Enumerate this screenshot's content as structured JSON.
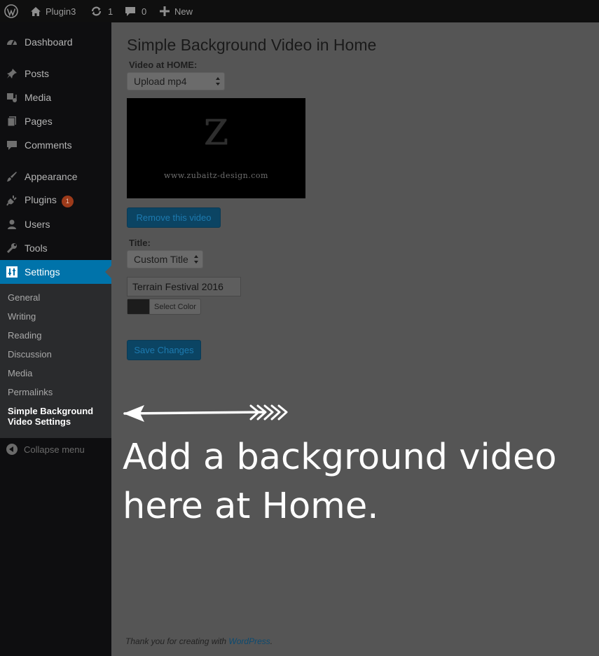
{
  "adminbar": {
    "site_name": "Plugin3",
    "updates_count": "1",
    "comments_count": "0",
    "new_label": "New"
  },
  "sidebar": {
    "items": [
      {
        "label": "Dashboard",
        "icon": "dashboard-icon"
      },
      {
        "label": "Posts",
        "icon": "pin-icon"
      },
      {
        "label": "Media",
        "icon": "media-icon"
      },
      {
        "label": "Pages",
        "icon": "pages-icon"
      },
      {
        "label": "Comments",
        "icon": "comment-icon"
      },
      {
        "label": "Appearance",
        "icon": "brush-icon"
      },
      {
        "label": "Plugins",
        "icon": "plug-icon",
        "badge": "1"
      },
      {
        "label": "Users",
        "icon": "user-icon"
      },
      {
        "label": "Tools",
        "icon": "wrench-icon"
      },
      {
        "label": "Settings",
        "icon": "settings-icon"
      }
    ],
    "submenu": [
      "General",
      "Writing",
      "Reading",
      "Discussion",
      "Media",
      "Permalinks"
    ],
    "submenu_current": [
      "Simple Background",
      "Video Settings"
    ],
    "collapse_label": "Collapse menu"
  },
  "main": {
    "title": "Simple Background Video in Home",
    "video_label": "Video at HOME:",
    "video_select_value": "Upload mp4",
    "video_preview_letter": "Z",
    "video_preview_caption": "www.zubaitz-design.com",
    "remove_button": "Remove this video",
    "title_label": "Title:",
    "title_select_value": "Custom Title",
    "title_input_value": "Terrain Festival 2016",
    "select_color_label": "Select Color",
    "selected_color": "#1c1c1c",
    "save_button": "Save Changes"
  },
  "annotation": {
    "line1": "Add a background video",
    "line2": "here at Home."
  },
  "footer": {
    "text": "Thank you for creating with ",
    "link": "WordPress",
    "suffix": "."
  },
  "colors": {
    "admin_bar": "#0f0f0f",
    "sidebar": "#0e0e10",
    "submenu": "#2a2b2d",
    "active_menu": "#0073aa",
    "content_overlay": "#555555",
    "primary_button": "#0b4463"
  }
}
